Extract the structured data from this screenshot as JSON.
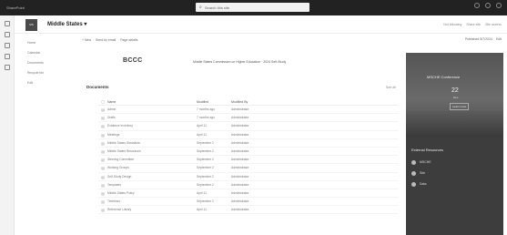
{
  "suitebar": {
    "app_name": "SharePoint",
    "search_placeholder": "Search this site"
  },
  "site": {
    "logo_text": "MS",
    "name": "Middle States ▾",
    "header_right": [
      "Not following",
      "Share site",
      "Site access"
    ]
  },
  "leftnav": {
    "items": [
      "Home",
      "Calendar",
      "Documents",
      "Recycle bin",
      "Edit"
    ]
  },
  "commandbar": {
    "left": [
      "+ New",
      "Send by email",
      "Page details"
    ],
    "right": [
      "Published 8/7/2024",
      "Edit"
    ]
  },
  "banner": {
    "logo": "BCCC",
    "title": "Middle States Commission on Higher Education · 2024 Self-Study"
  },
  "documents": {
    "title": "Documents",
    "see_all": "See all",
    "columns": [
      "Name",
      "Modified",
      "Modified By"
    ],
    "rows": [
      [
        "Admin",
        "7 months ago",
        "Administrator"
      ],
      [
        "Drafts",
        "7 months ago",
        "Administrator"
      ],
      [
        "Evidence Inventory",
        "April 11",
        "Administrator"
      ],
      [
        "Meetings",
        "April 11",
        "Administrator"
      ],
      [
        "Middle States Standards",
        "September 2",
        "Administrator"
      ],
      [
        "Middle States Resources",
        "September 2",
        "Administrator"
      ],
      [
        "Steering Committee",
        "September 2",
        "Administrator"
      ],
      [
        "Working Groups",
        "September 2",
        "Administrator"
      ],
      [
        "Self-Study Design",
        "September 2",
        "Administrator"
      ],
      [
        "Templates",
        "September 2",
        "Administrator"
      ],
      [
        "Middle States Policy",
        "April 11",
        "Administrator"
      ],
      [
        "Timelines",
        "September 2",
        "Administrator"
      ],
      [
        "Reference Library",
        "April 11",
        "Administrator"
      ]
    ]
  },
  "hero": {
    "event_title": "MSCHE Conference",
    "event_date": "22",
    "event_sub": "Dec",
    "event_button": "Learn more",
    "links_heading": "External Resources",
    "links": [
      "MSCHE",
      "Site",
      "Data"
    ]
  }
}
